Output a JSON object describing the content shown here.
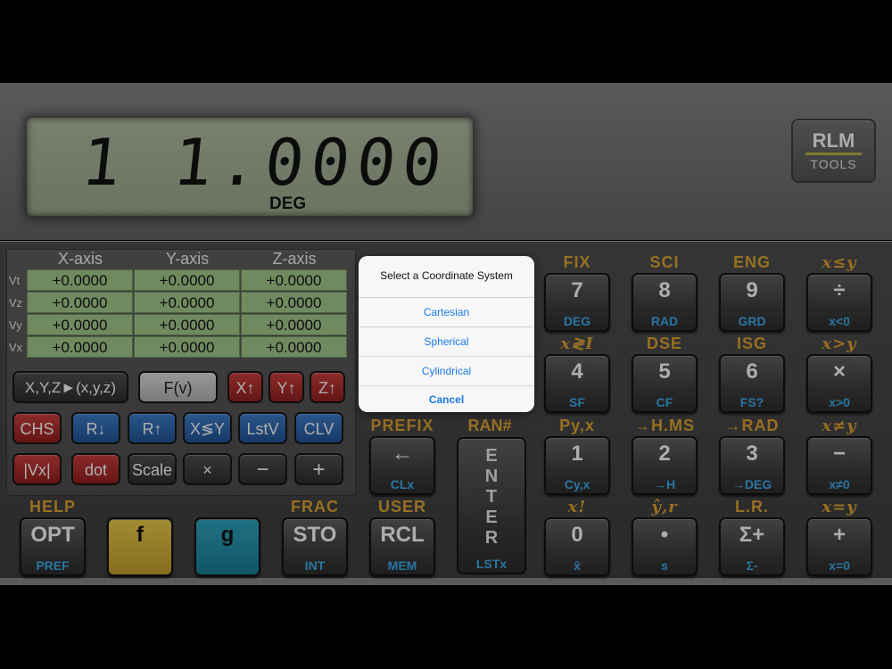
{
  "display": {
    "value": "1 1.0000",
    "mode": "DEG"
  },
  "brand": {
    "line1": "RLM",
    "line2": "TOOLS"
  },
  "keys": {
    "r1": [
      {
        "top": "FIX",
        "main": "7",
        "bot": "DEG"
      },
      {
        "top": "SCI",
        "main": "8",
        "bot": "RAD"
      },
      {
        "top": "ENG",
        "main": "9",
        "bot": "GRD"
      },
      {
        "top": "x≤y",
        "main": "÷",
        "bot": "x<0"
      }
    ],
    "r2": [
      {
        "top": "x≷I",
        "main": "4",
        "bot": "SF"
      },
      {
        "top": "DSE",
        "main": "5",
        "bot": "CF"
      },
      {
        "top": "ISG",
        "main": "6",
        "bot": "FS?"
      },
      {
        "top": "x>y",
        "main": "×",
        "bot": "x>0"
      }
    ],
    "r3": [
      {
        "top": "PREFIX",
        "main": "←",
        "bot": "CLx"
      },
      {
        "top": "Py,x",
        "main": "1",
        "bot": "Cy,x"
      },
      {
        "top": "→H.MS",
        "main": "2",
        "bot": "→H"
      },
      {
        "top": "→RAD",
        "main": "3",
        "bot": "→DEG"
      },
      {
        "top": "x≠y",
        "main": "−",
        "bot": "x≠0"
      }
    ],
    "r4": [
      {
        "top": "HELP",
        "main": "OPT",
        "bot": "PREF"
      },
      {
        "top": "",
        "main": "f",
        "bot": ""
      },
      {
        "top": "",
        "main": "g",
        "bot": ""
      },
      {
        "top": "FRAC",
        "main": "STO",
        "bot": "INT"
      },
      {
        "top": "USER",
        "main": "RCL",
        "bot": "MEM"
      },
      {
        "top": "x!",
        "main": "0",
        "bot": "x̄"
      },
      {
        "top": "ŷ,r",
        "main": "•",
        "bot": "s"
      },
      {
        "top": "L.R.",
        "main": "Σ+",
        "bot": "Σ-"
      },
      {
        "top": "x=y",
        "main": "+",
        "bot": "x=0"
      }
    ],
    "enter": {
      "top": "RAN#",
      "letters": "E N T E R",
      "bot": "LSTx"
    }
  },
  "vector_panel": {
    "headers": [
      "X-axis",
      "Y-axis",
      "Z-axis"
    ],
    "rows": [
      {
        "label": "Vt",
        "values": [
          "+0.0000",
          "+0.0000",
          "+0.0000"
        ]
      },
      {
        "label": "Vz",
        "values": [
          "+0.0000",
          "+0.0000",
          "+0.0000"
        ]
      },
      {
        "label": "Vy",
        "values": [
          "+0.0000",
          "+0.0000",
          "+0.0000"
        ]
      },
      {
        "label": "Vx",
        "values": [
          "+0.0000",
          "+0.0000",
          "+0.0000"
        ]
      }
    ],
    "buttons": {
      "row1": [
        "X,Y,Z►(x,y,z)",
        "F(v)",
        "X↑",
        "Y↑",
        "Z↑"
      ],
      "row2": [
        "CHS",
        "R↓",
        "R↑",
        "X≶Y",
        "LstV",
        "CLV"
      ],
      "row3": [
        "|Vx|",
        "dot",
        "Scale",
        "×",
        "−",
        "+"
      ]
    }
  },
  "dialog": {
    "title": "Select a Coordinate System",
    "options": [
      "Cartesian",
      "Spherical",
      "Cylindrical"
    ],
    "cancel": "Cancel"
  }
}
